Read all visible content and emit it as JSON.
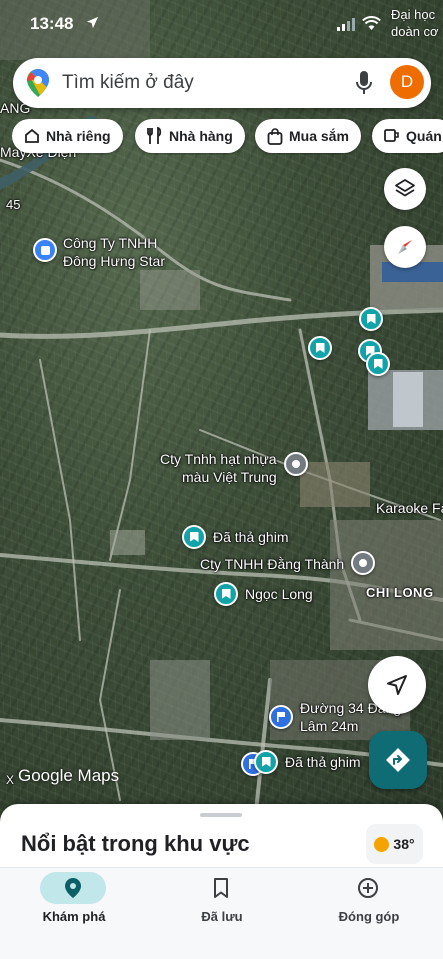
{
  "status_bar": {
    "time": "13:48",
    "carrier_text": "Đại học\ndoàn cơ"
  },
  "search": {
    "placeholder": "Tìm kiếm ở đây",
    "avatar_letter": "D"
  },
  "chips": [
    {
      "label": "Nhà riêng",
      "icon": "home-icon"
    },
    {
      "label": "Nhà hàng",
      "icon": "restaurant-icon"
    },
    {
      "label": "Mua sắm",
      "icon": "shopping-bag-icon"
    },
    {
      "label": "Quán",
      "icon": "coffee-icon"
    }
  ],
  "map": {
    "labels": {
      "top_left_1": "ANG",
      "top_left_2": "MayXe Điện",
      "road_number": "45",
      "company_1_line1": "Công Ty TNHH",
      "company_1_line2": "Đông Hưng Star",
      "cty_line1": "Cty Tnhh hạt nhựa",
      "cty_line2": "màu Việt Trung",
      "karaoke": "Karaoke Fa",
      "pinned_1": "Đã thả ghim",
      "dang_thanh": "Cty TNHH Đằng Thành",
      "chi_long": "CHI LONG",
      "ngoc_long": "Ngọc Long",
      "duong_line1": "Đường 34 Đằng",
      "duong_line2": "Lâm 24m",
      "pinned_2": "Đã thả ghim",
      "google_maps": "Google Maps",
      "bottom_left": "X"
    }
  },
  "sheet": {
    "title": "Nổi bật trong khu vực",
    "temperature": "38°"
  },
  "nav": [
    {
      "label": "Khám phá",
      "active": true
    },
    {
      "label": "Đã lưu",
      "active": false
    },
    {
      "label": "Đóng góp",
      "active": false
    }
  ],
  "colors": {
    "accent": "#0f6c74",
    "pin": "#12a3a8",
    "avatar": "#ef6c00"
  }
}
